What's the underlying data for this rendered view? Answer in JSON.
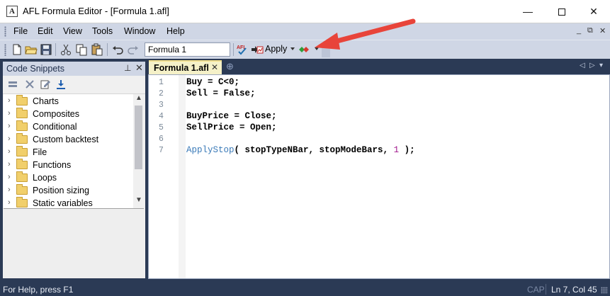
{
  "window": {
    "title": "AFL Formula Editor - [Formula 1.afl]",
    "app_icon_glyph": "A",
    "minimize_glyph": "—",
    "close_glyph": "✕"
  },
  "menu": {
    "items": [
      "File",
      "Edit",
      "View",
      "Tools",
      "Window",
      "Help"
    ],
    "mdi_minimize": "_",
    "mdi_restore": "⧉",
    "mdi_close": "✕"
  },
  "toolbar": {
    "formula_name": "Formula 1",
    "apply_label": "Apply",
    "icons": [
      "new-file-icon",
      "open-folder-icon",
      "save-icon",
      "cut-icon",
      "copy-icon",
      "paste-icon",
      "undo-icon",
      "redo-icon",
      "afl-check-icon",
      "send-chart-icon",
      "backtest-icon"
    ]
  },
  "annotation": {
    "arrow_color": "#e8443a"
  },
  "snippets_panel": {
    "title": "Code Snippets",
    "pin_glyph": "⊥",
    "close_glyph": "✕",
    "items": [
      {
        "label": "Charts"
      },
      {
        "label": "Composites"
      },
      {
        "label": "Conditional"
      },
      {
        "label": "Custom backtest"
      },
      {
        "label": "File"
      },
      {
        "label": "Functions"
      },
      {
        "label": "Loops"
      },
      {
        "label": "Position sizing"
      },
      {
        "label": "Static variables"
      }
    ]
  },
  "editor": {
    "tab_label": "Formula 1.afl",
    "tab_close_glyph": "✕",
    "new_tab_glyph": "⊕",
    "nav_left": "◁",
    "nav_right": "▷",
    "nav_menu": "▾",
    "line_numbers": [
      "1",
      "2",
      "3",
      "4",
      "5",
      "6",
      "7"
    ],
    "lines": {
      "l1": "Buy = C<0;",
      "l2": "Sell = False;",
      "l3": "",
      "l4": "BuyPrice = Close;",
      "l5": "SellPrice = Open;",
      "l6": "",
      "l7_fn": "ApplyStop",
      "l7_open": "( stopTypeNBar, stopModeBars, ",
      "l7_num": "1",
      "l7_close": " );"
    }
  },
  "status": {
    "help": "For Help, press F1",
    "cap": "CAP",
    "position": "Ln 7, Col 45"
  }
}
